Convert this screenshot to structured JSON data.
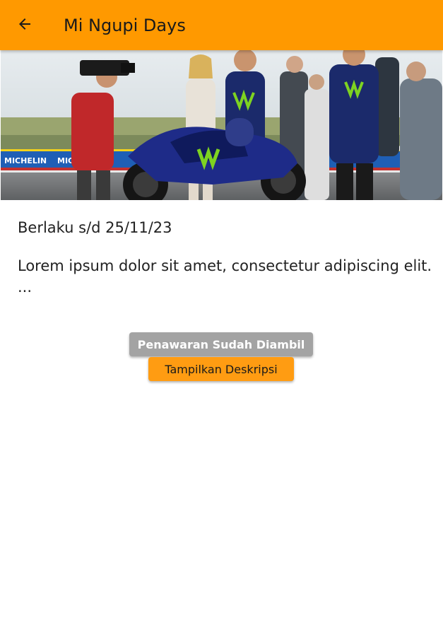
{
  "appbar": {
    "title": "Mi Ngupi Days",
    "back_icon": "arrow-left-icon",
    "color": "#ff9900"
  },
  "banner": {
    "ad_text": "MICHELIN"
  },
  "offer": {
    "validity": "Berlaku s/d 25/11/23",
    "description": "Lorem ipsum dolor sit amet, consectetur adipiscing elit.",
    "description_more": "..."
  },
  "buttons": {
    "taken_label": "Penawaran Sudah Diambil",
    "show_description_label": "Tampilkan Deskripsi"
  },
  "colors": {
    "accent": "#ff9900",
    "disabled_button": "#a3a3a3"
  }
}
